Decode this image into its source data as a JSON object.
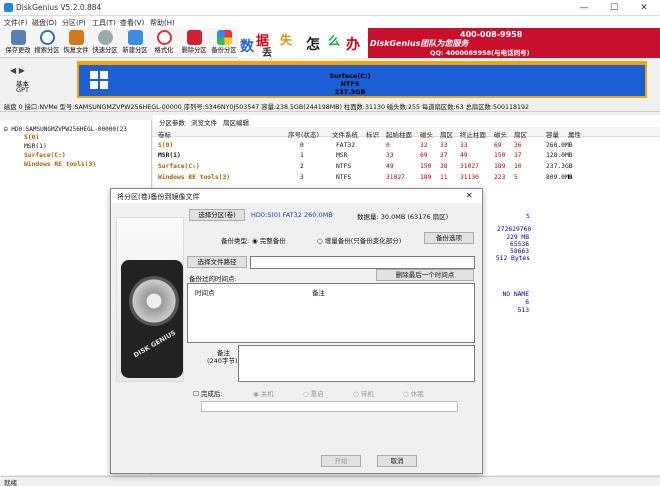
{
  "app": {
    "title": "DiskGenius V5.2.0.884",
    "min": "—",
    "max": "☐",
    "close": "✕"
  },
  "menu": [
    "文件(F)",
    "磁盘(D)",
    "分区(P)",
    "工具(T)",
    "查看(V)",
    "帮助(H)"
  ],
  "toolbar": [
    {
      "label": "保存更改",
      "color": "#5a7fb5"
    },
    {
      "label": "搜索分区",
      "color": "#2f6fb8"
    },
    {
      "label": "恢复文件",
      "color": "#d07b20"
    },
    {
      "label": "快速分区",
      "color": "#5b9bd5"
    },
    {
      "label": "新建分区",
      "color": "#3b8ee0"
    },
    {
      "label": "格式化",
      "color": "#d33"
    },
    {
      "label": "删除分区",
      "color": "#c23"
    },
    {
      "label": "备份分区",
      "color": "#3ba"
    }
  ],
  "banner": {
    "chars": [
      "数",
      "据",
      "丢",
      "失",
      "怎",
      "么",
      "办"
    ],
    "slogan": "DiskGenius团队为您服务",
    "phone": "400-008-9958",
    "qq": "QQ: 4000089958(与电话同号)"
  },
  "diskmap": {
    "basic": "基本",
    "gpt": "GPT",
    "part_name": "Surface(C:)",
    "part_fs": "NTFS",
    "part_size": "237.3GB"
  },
  "infobar": "磁盘 0 接口:NVMe  型号:SAMSUNGMZVPW256HEGL-00000  序列号:S346NY0J503547  容量:238.5GB(244198MB)  柱面数:31130  磁头数:255  每道扇区数:63  总扇区数:500118192",
  "tree": {
    "disk": "HD0:SAMSUNGMZVPW256HEGL-00000(23",
    "items": [
      "S(0)",
      "MSR(1)",
      "Surface(C:)",
      "Windows RE tools(3)"
    ],
    "nvme": "NVMe"
  },
  "tabs": [
    "分区参数",
    "浏览文件",
    "扇区编辑"
  ],
  "table": {
    "headers": [
      "卷标",
      "序号(状态)",
      "文件系统",
      "标识",
      "起始柱面",
      "磁头",
      "扇区",
      "终止柱面",
      "磁头",
      "扇区",
      "容量",
      "属性"
    ],
    "rows": [
      [
        "S(0)",
        "0",
        "FAT32",
        "",
        "0",
        "32",
        "33",
        "33",
        "69",
        "36",
        "260.0MB",
        ""
      ],
      [
        "MSR(1)",
        "1",
        "MSR",
        "",
        "33",
        "69",
        "37",
        "49",
        "150",
        "37",
        "128.0MB",
        ""
      ],
      [
        "Surface(C:)",
        "2",
        "NTFS",
        "",
        "49",
        "150",
        "38",
        "31027",
        "189",
        "10",
        "237.3GB",
        ""
      ],
      [
        "Windows RE tools(3)",
        "3",
        "NTFS",
        "",
        "31027",
        "189",
        "11",
        "31130",
        "223",
        "5",
        "809.0MB",
        "H"
      ]
    ]
  },
  "rightinfo": [
    "S",
    "272629760",
    "229 MB",
    "65536",
    "58663",
    "512 Bytes",
    "NO NAME",
    "6",
    "513"
  ],
  "dialog": {
    "title": "将分区(卷)备份到镜像文件",
    "select_btn": "选择分区(卷)",
    "selected": "HD0:S(0) FAT32 260.0MB",
    "data_size": "数据量: 30.0MB (63176 扇区)",
    "backup_type": "备份类型:",
    "full": "完整备份",
    "incremental": "增量备份(只备份变化部分)",
    "options_btn": "备份选项",
    "choose_path_btn": "选择文件路径",
    "points_label": "备份过的时间点:",
    "delete_last_btn": "删除最后一个时间点",
    "col_time": "时间点",
    "col_note": "备注",
    "note_label": "备注",
    "note_limit": "(240字节)",
    "after_done": "完成后:",
    "shutdown": "关机",
    "restart": "重启",
    "standby": "待机",
    "hibernate": "休眠",
    "start_btn": "开始",
    "cancel_btn": "取消",
    "close": "✕"
  },
  "status": "就绪"
}
